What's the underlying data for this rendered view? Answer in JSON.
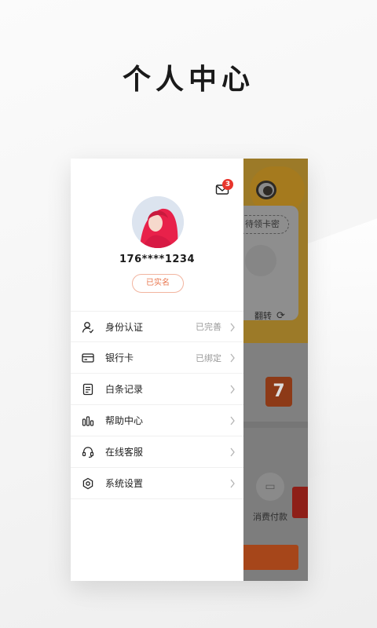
{
  "page": {
    "title": "个人中心"
  },
  "background_app": {
    "card_pill": "待领卡密",
    "flip_label": "翻转",
    "calendar_day": "7",
    "wallet_label": "消费付款"
  },
  "drawer": {
    "mail_badge_count": "3",
    "phone_number": "176****1234",
    "verified_label": "已实名",
    "menu": [
      {
        "label": "身份认证",
        "status": "已完善",
        "icon": "user-icon"
      },
      {
        "label": "银行卡",
        "status": "已绑定",
        "icon": "card-icon"
      },
      {
        "label": "白条记录",
        "status": "",
        "icon": "document-icon"
      },
      {
        "label": "帮助中心",
        "status": "",
        "icon": "bar-chart-icon"
      },
      {
        "label": "在线客服",
        "status": "",
        "icon": "headset-icon"
      },
      {
        "label": "系统设置",
        "status": "",
        "icon": "gear-icon"
      }
    ]
  },
  "colors": {
    "accent": "#e9774f",
    "badge": "#e8352c",
    "overlay": "#7d7d7d"
  }
}
